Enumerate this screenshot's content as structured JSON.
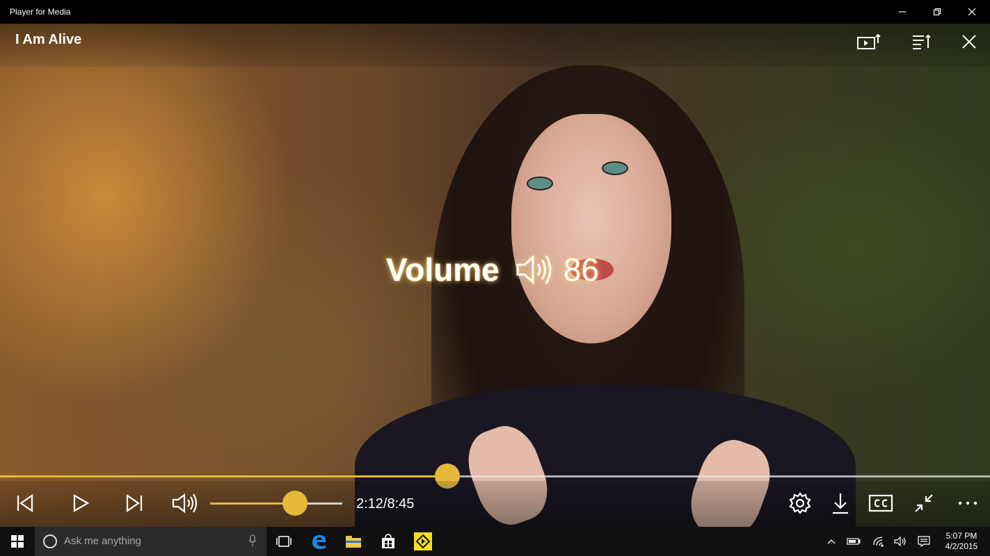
{
  "window": {
    "app_title": "Player for Media",
    "controls": [
      "minimize-icon",
      "maximize-icon",
      "close-icon"
    ]
  },
  "top_bar": {
    "media_title": "I Am Alive",
    "icons": [
      "cast-screen-icon",
      "playlist-icon",
      "close-icon"
    ]
  },
  "osd": {
    "label": "Volume",
    "icon": "speaker-icon",
    "value": "86"
  },
  "seek": {
    "progress_fraction": 0.452,
    "current_time": "2:12",
    "total_time": "8:45"
  },
  "controls": {
    "left_icons": [
      "skip-previous-icon",
      "play-icon",
      "skip-next-icon",
      "volume-icon"
    ],
    "volume_level": 0.64,
    "time_display": "2:12/8:45",
    "right_icons": [
      "settings-gear-icon",
      "download-icon",
      "closed-captions-icon",
      "exit-fullscreen-icon",
      "more-options-icon"
    ]
  },
  "taskbar": {
    "search_placeholder": "Ask me anything",
    "apps": [
      "task-view-icon",
      "edge-browser-icon",
      "file-explorer-icon",
      "store-icon",
      "media-player-app-icon"
    ],
    "tray_icons": [
      "show-hidden-icons-icon",
      "battery-icon",
      "wifi-icon",
      "speaker-icon",
      "action-center-icon"
    ],
    "clock_time": "5:07 PM",
    "clock_date": "4/2/2015"
  },
  "colors": {
    "accent": "#e6b93a",
    "titlebar": "#000000",
    "taskbar": "#101010",
    "searchbox": "#2b2b2b"
  }
}
